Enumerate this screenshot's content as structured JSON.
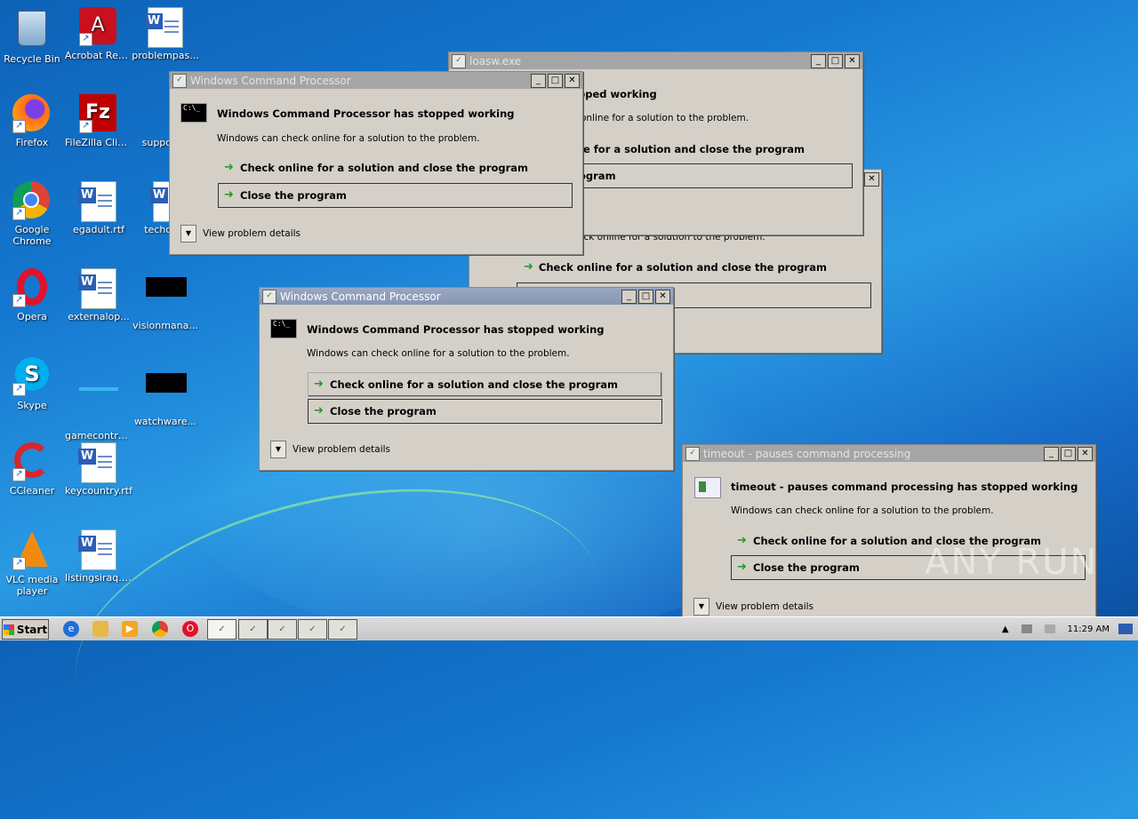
{
  "desktop": {
    "icons": [
      {
        "label": "Recycle Bin"
      },
      {
        "label": "Acrobat Reader DC"
      },
      {
        "label": "problempas..."
      },
      {
        "label": "Firefox"
      },
      {
        "label": "FileZilla Client"
      },
      {
        "label": "support..."
      },
      {
        "label": "Google Chrome"
      },
      {
        "label": "egadult.rtf"
      },
      {
        "label": "techch..."
      },
      {
        "label": "Opera"
      },
      {
        "label": "externalop..."
      },
      {
        "label": "visionmana..."
      },
      {
        "label": "Skype"
      },
      {
        "label": "gamecontra..."
      },
      {
        "label": "watchware..."
      },
      {
        "label": "CCleaner"
      },
      {
        "label": "keycountry.rtf"
      },
      {
        "label": "VLC media player"
      },
      {
        "label": "listingsiraq.rtf"
      }
    ]
  },
  "dialogs": {
    "loasw": {
      "title": "loasw.exe",
      "header": "pped working",
      "subtitle": "online for a solution to the problem.",
      "option1": "e for a solution and close the program",
      "option2": "ogram"
    },
    "hidden": {
      "subtitle": "eck online for a solution to the problem.",
      "option1": "Check online for a solution and close the program"
    },
    "wcp1": {
      "title": "Windows Command Processor",
      "header": "Windows Command Processor has stopped working",
      "subtitle": "Windows can check online for a solution to the problem.",
      "option1": "Check online for a solution and close the program",
      "option2": "Close the program",
      "details": "View problem details"
    },
    "wcp2": {
      "title": "Windows Command Processor",
      "header": "Windows Command Processor has stopped working",
      "subtitle": "Windows can check online for a solution to the problem.",
      "option1": "Check online for a solution and close the program",
      "option2": "Close the program",
      "details": "View problem details"
    },
    "timeout": {
      "title": "timeout - pauses command processing",
      "header": "timeout - pauses command processing has stopped working",
      "subtitle": "Windows can check online for a solution to the problem.",
      "option1": "Check online for a solution and close the program",
      "option2": "Close the program",
      "details": "View problem details"
    }
  },
  "taskbar": {
    "start_label": "Start",
    "clock": "11:29 AM"
  },
  "watermark": "ANY RUN"
}
